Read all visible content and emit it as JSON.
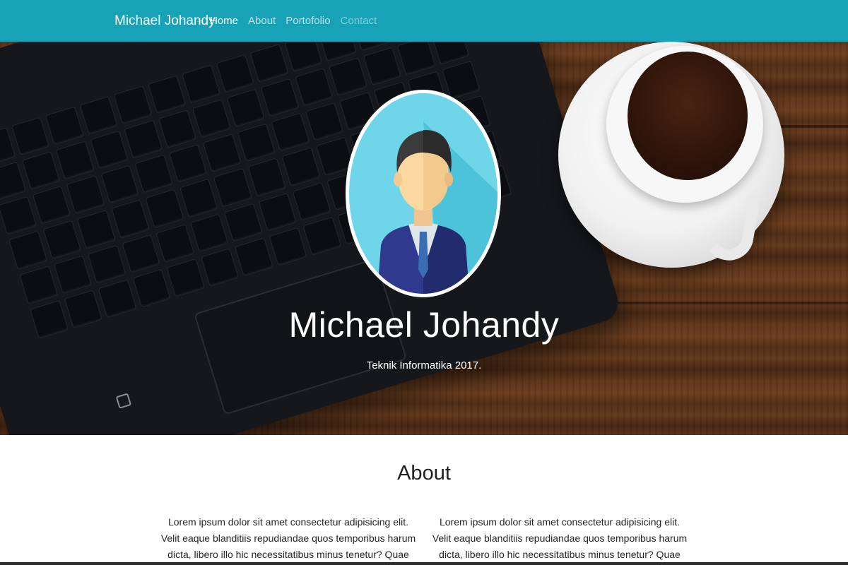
{
  "navbar": {
    "brand": "Michael Johandy",
    "links": [
      {
        "label": "Home"
      },
      {
        "label": "About"
      },
      {
        "label": "Portofolio"
      },
      {
        "label": "Contact"
      }
    ],
    "background": "#17a2b8"
  },
  "hero": {
    "avatar_icon": "businessman-avatar-icon",
    "name": "Michael Johandy",
    "subtitle": "Teknik Informatika 2017."
  },
  "about": {
    "title": "About",
    "columns": [
      {
        "text": "Lorem ipsum dolor sit amet consectetur adipisicing elit. Velit eaque blanditiis repudiandae quos temporibus harum dicta, libero illo hic necessitatibus minus tenetur? Quae accusantium"
      },
      {
        "text": "Lorem ipsum dolor sit amet consectetur adipisicing elit. Velit eaque blanditiis repudiandae quos temporibus harum dicta, libero illo hic necessitatibus minus tenetur? Quae accusantium"
      }
    ]
  }
}
